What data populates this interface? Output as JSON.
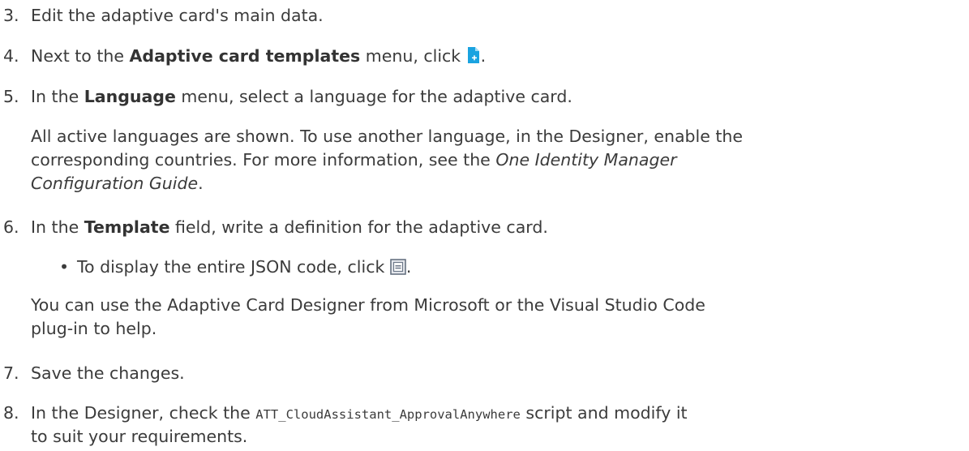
{
  "steps": [
    {
      "number": "3.",
      "text": "Edit the adaptive card's main data."
    },
    {
      "number": "4.",
      "pre": "Next to the ",
      "bold": "Adaptive card templates",
      "post": " menu, click ",
      "end": "."
    },
    {
      "number": "5.",
      "pre": "In the ",
      "bold": "Language",
      "post": " menu, select a language for the adaptive card."
    },
    {
      "number": "6.",
      "pre": "In the ",
      "bold": "Template",
      "post": " field, write a definition for the adaptive card."
    },
    {
      "number": "7.",
      "text": "Save the changes."
    },
    {
      "number": "8.",
      "pre": "In the Designer, check the ",
      "code": "ATT_CloudAssistant_ApprovalAnywhere",
      "post": " script and modify it",
      "line2": "to suit your requirements."
    }
  ],
  "language_note": {
    "line1": "All active languages are shown. To use another language, in the Designer, enable the",
    "line2_pre": "corresponding countries. For more information, see the ",
    "line2_italic": "One Identity Manager",
    "line3_italic": "Configuration Guide",
    "line3_post": "."
  },
  "template_bullet": {
    "marker": "•",
    "text": "To display the entire JSON code, click ",
    "end": "."
  },
  "template_note": {
    "line1": "You can use the Adaptive Card Designer from Microsoft or the Visual Studio Code",
    "line2": "plug-in to help."
  },
  "icons": {
    "new_template": "new-document-icon",
    "expand_code": "expand-view-icon"
  },
  "colors": {
    "accent": "#1aa3e0",
    "text": "#3b3b3b"
  }
}
